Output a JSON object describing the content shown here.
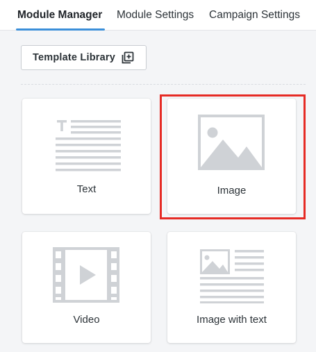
{
  "tabs": [
    {
      "label": "Module Manager",
      "active": true
    },
    {
      "label": "Module Settings",
      "active": false
    },
    {
      "label": "Campaign Settings",
      "active": false
    }
  ],
  "toolbar": {
    "template_library_label": "Template Library",
    "template_library_icon": "add-to-library-icon"
  },
  "modules": [
    {
      "label": "Text",
      "icon": "text-block-icon"
    },
    {
      "label": "Image",
      "icon": "image-placeholder-icon",
      "highlighted": true
    },
    {
      "label": "Video",
      "icon": "film-strip-play-icon"
    },
    {
      "label": "Image with text",
      "icon": "image-with-text-icon"
    }
  ],
  "colors": {
    "accent": "#3b8fd9",
    "highlight": "#e62b25",
    "icon_gray": "#cfd2d6",
    "background": "#f4f5f7"
  }
}
